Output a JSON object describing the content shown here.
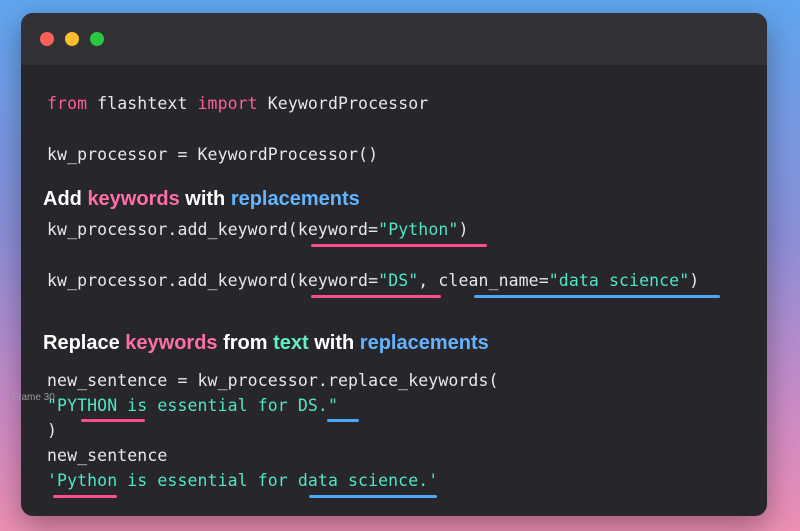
{
  "window": {
    "traffic_lights": [
      "close",
      "minimize",
      "maximize"
    ]
  },
  "code": {
    "import_line": {
      "from": "from",
      "module": " flashtext ",
      "import": "import",
      "name": " KeywordProcessor"
    },
    "init_line": "kw_processor = KeywordProcessor()",
    "add1": {
      "prefix": "kw_processor.add_keyword(",
      "param": "keyword",
      "eq": "=",
      "value": "\"Python\"",
      "suffix": ")"
    },
    "add2": {
      "prefix": "kw_processor.add_keyword(",
      "param1": "keyword",
      "eq1": "=",
      "value1": "\"DS\"",
      "sep": ", ",
      "param2": "clean_name",
      "eq2": "=",
      "value2": "\"data science\"",
      "suffix": ")"
    },
    "replace_line": "new_sentence = kw_processor.replace_keywords(",
    "input_string": "\"PYTHON is essential for DS.\"",
    "close_paren": ")",
    "output_var": "new_sentence",
    "output_string": "'Python is essential for data science.'"
  },
  "headings": {
    "h1": {
      "w1": "Add ",
      "w2": "keywords",
      "w3": " with ",
      "w4": "replacements"
    },
    "h2": {
      "w1": "Replace ",
      "w2": "keywords",
      "w3": " from ",
      "w4": "text",
      "w5": " with ",
      "w6": "replacements"
    }
  },
  "overlay": {
    "frame_label": "Frame 30"
  },
  "colors": {
    "keyword_pink": "#ff5c9d",
    "string_teal": "#4fe6c7",
    "underline_pink": "#ff4d8e",
    "underline_blue": "#4aa8ff",
    "window_bg": "#26262b"
  }
}
